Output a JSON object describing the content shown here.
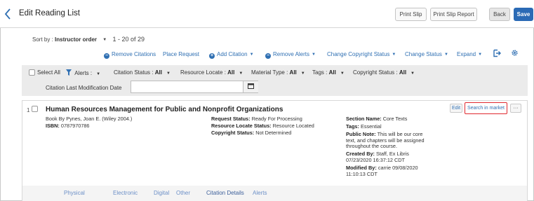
{
  "header": {
    "title": "Edit Reading List",
    "print_slip": "Print Slip",
    "print_slip_report": "Print Slip Report",
    "back": "Back",
    "save": "Save"
  },
  "sort": {
    "label": "Sort by : ",
    "value": "Instructor order",
    "range": "1 - 20 of 29"
  },
  "toolbar": {
    "remove_citations": "Remove Citations",
    "place_request": "Place Request",
    "add_citation": "Add Citation",
    "remove_alerts": "Remove Alerts",
    "change_copyright": "Change Copyright Status",
    "change_status": "Change Status",
    "expand": "Expand"
  },
  "filters": {
    "select_all": "Select All",
    "alerts": "Alerts :",
    "citation_status_label": "Citation Status : ",
    "citation_status_value": "All",
    "resource_locate_label": "Resource Locate : ",
    "resource_locate_value": "All",
    "material_type_label": "Material Type : ",
    "material_type_value": "All",
    "tags_label": "Tags : ",
    "tags_value": "All",
    "copyright_label": "Copyright Status : ",
    "copyright_value": "All",
    "date_label": "Citation Last Modification Date",
    "date_value": ""
  },
  "citation": {
    "index": "1",
    "title": "Human Resources Management for Public and Nonprofit Organizations",
    "byline": "Book By Pynes, Joan E. (Wiley 2004.)",
    "isbn_label": "ISBN: ",
    "isbn": "0787970786",
    "request_status_label": "Request Status: ",
    "request_status": "Ready For Processing",
    "resource_locate_label": "Resource Locate Status: ",
    "resource_locate": "Resource Located",
    "copyright_label": "Copyright Status: ",
    "copyright": "Not Determined",
    "section_label": "Section Name: ",
    "section": "Core Texts",
    "tags_label": "Tags: ",
    "tags": "Essential",
    "public_note_label": "Public Note: ",
    "public_note_1": "This will be our core",
    "public_note_2": "text, and chapters will be assigned",
    "public_note_3": "throughout the course.",
    "created_label": "Created By: ",
    "created_1": "Staff, Ex Libris",
    "created_2": "07/23/2020 16:37:12 CDT",
    "modified_label": "Modified By: ",
    "modified_1": "carrie 09/08/2020",
    "modified_2": "11:10:13 CDT",
    "edit": "Edit",
    "search_market": "Search in market",
    "more": "···"
  },
  "tabs": [
    "Physical",
    "Electronic",
    "Digital",
    "Other",
    "Citation Details",
    "Alerts"
  ],
  "colors": {
    "accent": "#3070b3",
    "highlight": "#e0282e",
    "save": "#2a6ab5"
  },
  "icons": {
    "back": "chevron-left-icon",
    "remove": "minus-circle-icon",
    "add": "plus-circle-icon",
    "export": "export-icon",
    "settings": "gear-icon",
    "filter": "funnel-icon",
    "calendar": "calendar-icon"
  }
}
